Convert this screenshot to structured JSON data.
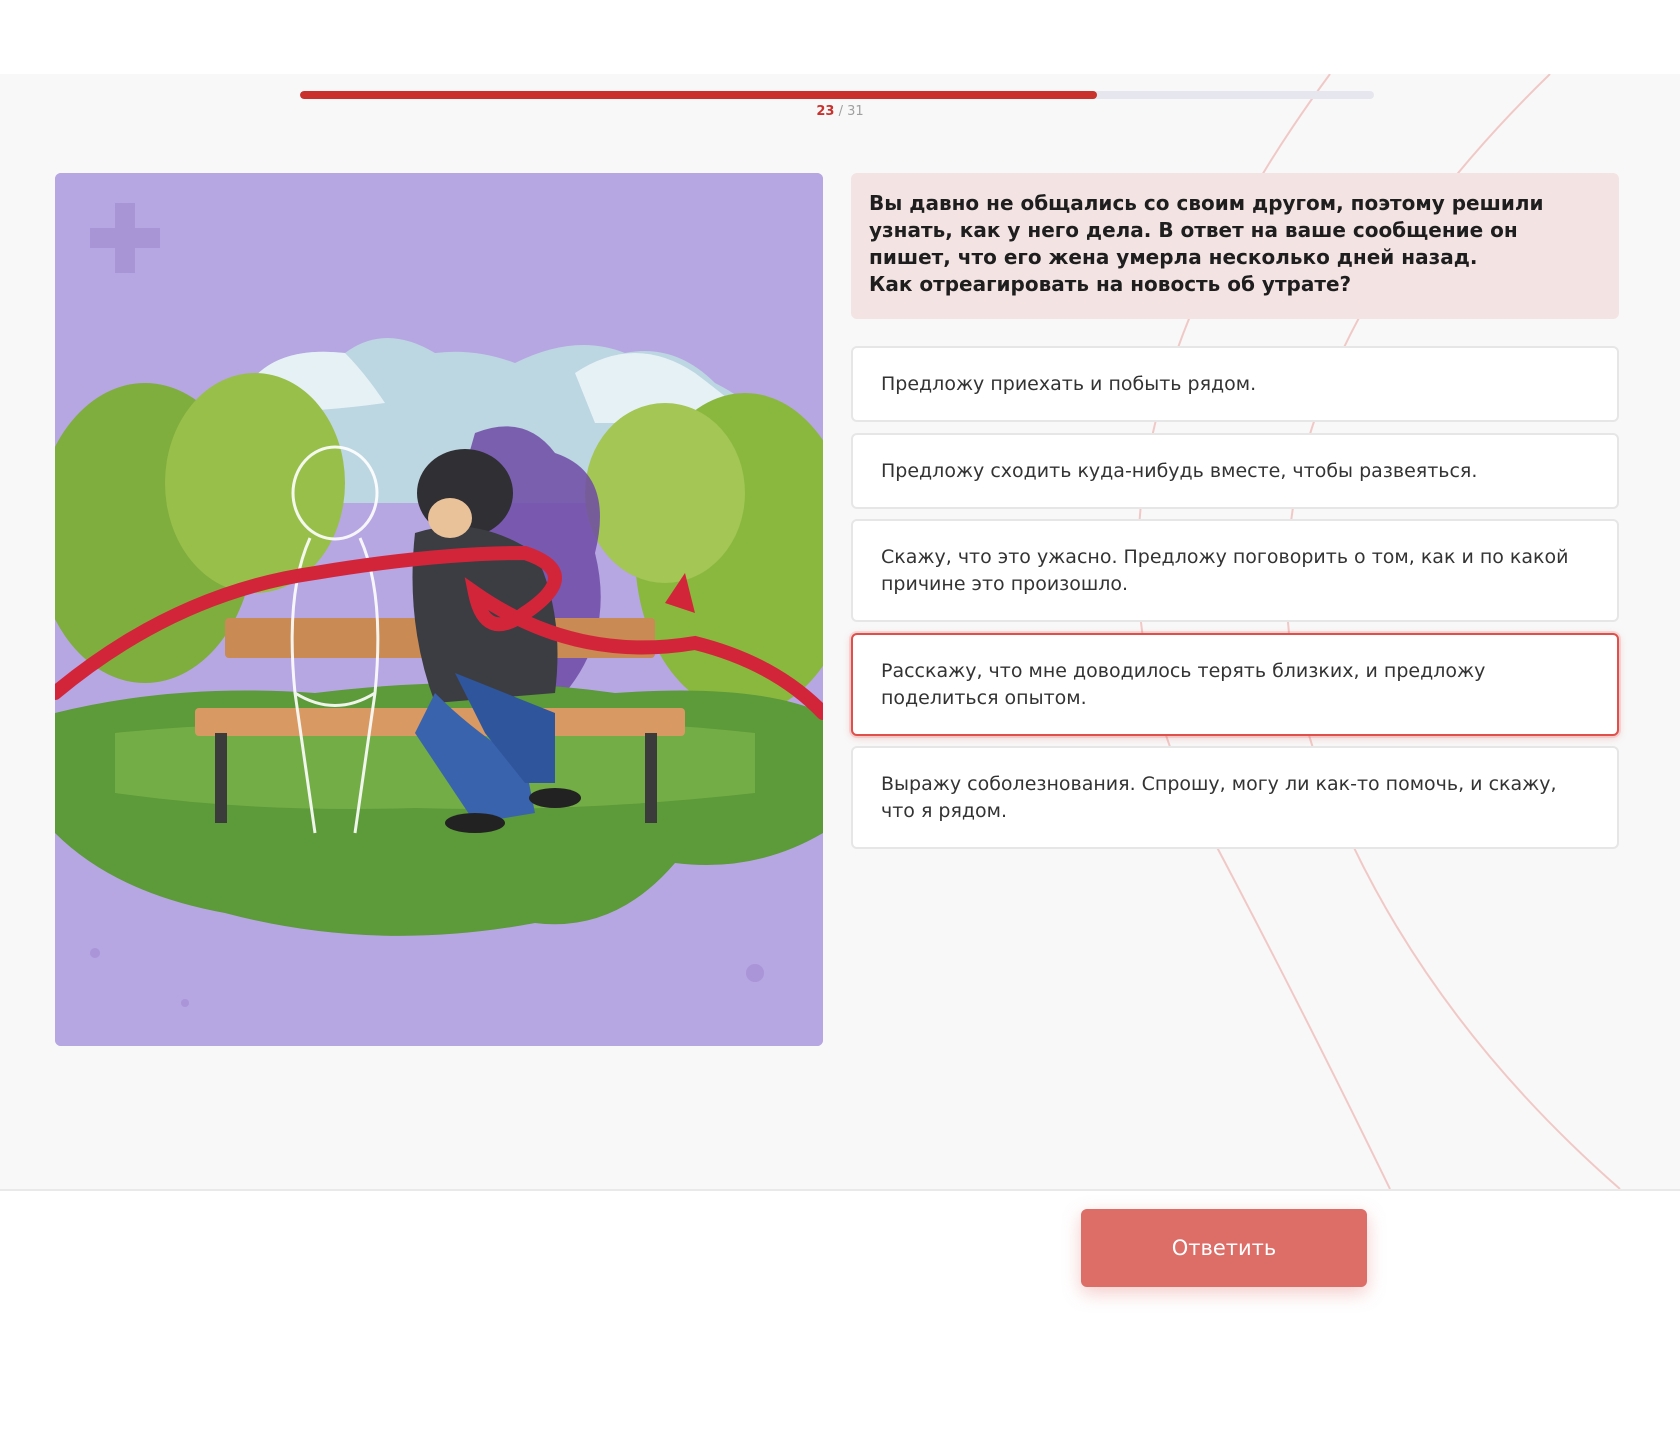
{
  "progress": {
    "current": "23",
    "separator": "/",
    "total": "31",
    "fraction": 0.742,
    "fill_color": "#c8312c"
  },
  "question": {
    "paragraph": "Вы давно не общались со своим другом, поэтому решили узнать, как у него дела. В ответ на ваше сообщение он пишет, что его жена умерла несколько дней назад.",
    "prompt": "Как отреагировать на новость об утрате?"
  },
  "answers": [
    {
      "label": "Предложу приехать и побыть рядом.",
      "selected": false
    },
    {
      "label": "Предложу сходить куда-нибудь вместе, чтобы развеяться.",
      "selected": false
    },
    {
      "label": "Скажу, что это ужасно. Предложу поговорить о том, как и по какой причине это произошло.",
      "selected": false
    },
    {
      "label": "Расскажу, что мне доводилось терять близких, и предложу поделиться опытом.",
      "selected": true
    },
    {
      "label": "Выражу соболезнования. Спрошу, могу ли как-то помочь, и скажу, что я рядом.",
      "selected": false
    }
  ],
  "submit": {
    "label": "Ответить"
  },
  "colors": {
    "accent": "#c8312c",
    "button": "#dc6d67",
    "question_bg": "#f3e4e3",
    "illustration_bg": "#b6a6e2"
  }
}
